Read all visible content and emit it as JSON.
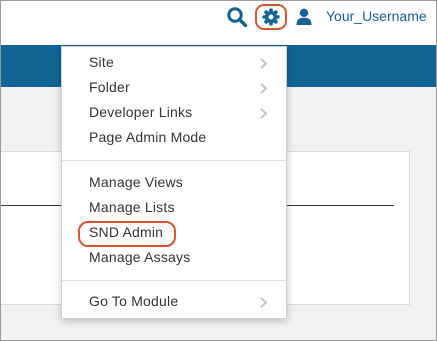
{
  "header": {
    "username": "Your_Username",
    "icons": [
      "search-icon",
      "gear-icon",
      "user-icon"
    ]
  },
  "menu": {
    "groups": [
      [
        {
          "label": "Site",
          "submenu": true
        },
        {
          "label": "Folder",
          "submenu": true
        },
        {
          "label": "Developer Links",
          "submenu": true
        },
        {
          "label": "Page Admin Mode",
          "submenu": false
        }
      ],
      [
        {
          "label": "Manage Views",
          "submenu": false
        },
        {
          "label": "Manage Lists",
          "submenu": false
        },
        {
          "label": "SND Admin",
          "submenu": false,
          "highlighted": true
        },
        {
          "label": "Manage Assays",
          "submenu": false
        }
      ],
      [
        {
          "label": "Go To Module",
          "submenu": true
        }
      ]
    ]
  },
  "colors": {
    "navbar": "#126495",
    "accent_link": "#126495",
    "highlight_ring": "#d9552b"
  }
}
